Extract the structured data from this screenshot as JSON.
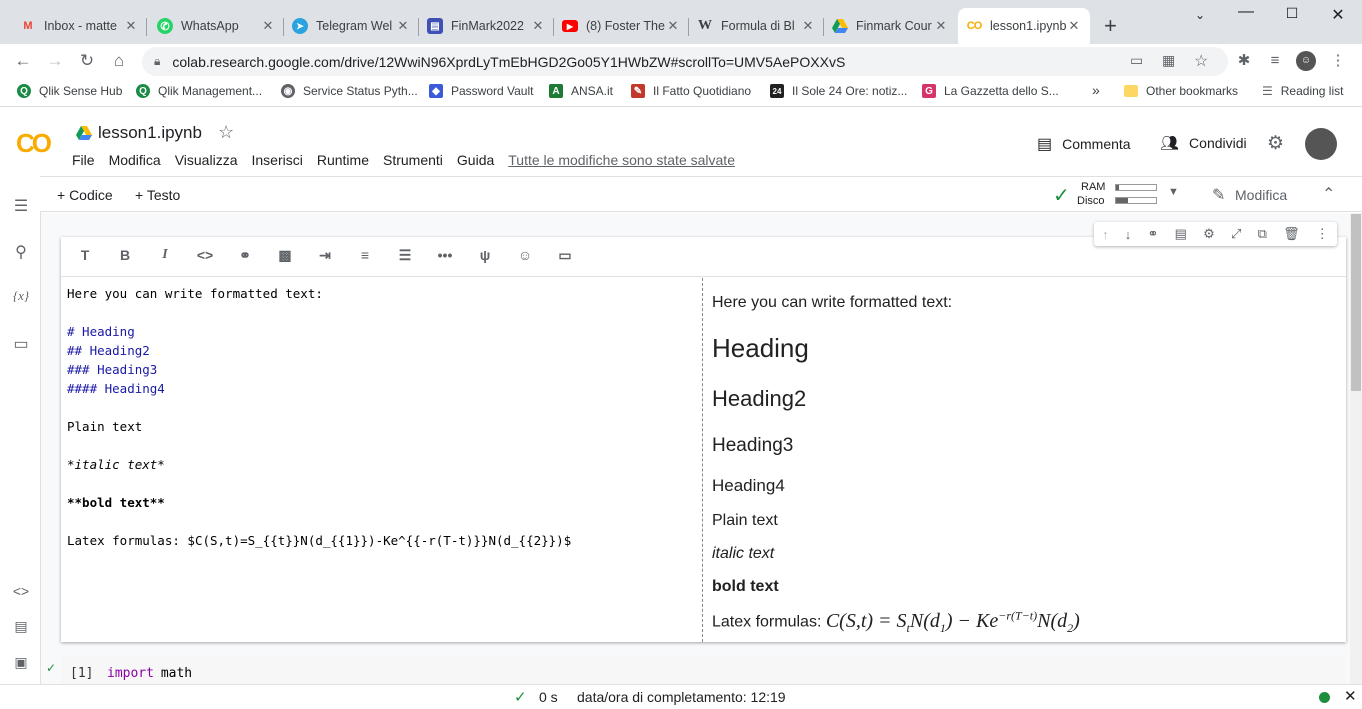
{
  "tabs": [
    {
      "label": "Inbox - matte",
      "icon": "gmail-icon",
      "color": "#ea4335",
      "glyph": "M"
    },
    {
      "label": "WhatsApp",
      "icon": "whatsapp-icon",
      "color": "#25d366",
      "glyph": "✆"
    },
    {
      "label": "Telegram Wel",
      "icon": "telegram-icon",
      "color": "#2aa3df",
      "glyph": "➤"
    },
    {
      "label": "FinMark2022",
      "icon": "forms-icon",
      "color": "#3f51b5",
      "glyph": "▤"
    },
    {
      "label": "(8) Foster The",
      "icon": "youtube-icon",
      "color": "#ff0000",
      "glyph": "▶"
    },
    {
      "label": "Formula di Bl",
      "icon": "wikipedia-icon",
      "color": "#fff",
      "glyph": "W"
    },
    {
      "label": "Finmark Cour",
      "icon": "drive-icon",
      "color": "#fff",
      "glyph": "▲"
    },
    {
      "label": "lesson1.ipynb",
      "icon": "colab-icon",
      "color": "#fff",
      "glyph": "CO"
    }
  ],
  "url": "colab.research.google.com/drive/12WwiN96XprdLyTmEbHGD2Go05Y1HWbZW#scrollTo=UMV5AePOXXvS",
  "bookmarks": [
    {
      "label": "Qlik Sense Hub",
      "color": "#1a8b45",
      "glyph": "Q"
    },
    {
      "label": "Qlik Management...",
      "color": "#1a8b45",
      "glyph": "Q"
    },
    {
      "label": "Service Status Pyth...",
      "color": "#5f6368",
      "glyph": "◉"
    },
    {
      "label": "Password Vault",
      "color": "#3b5bdb",
      "glyph": "◆"
    },
    {
      "label": "ANSA.it",
      "color": "#1d7a34",
      "glyph": "A"
    },
    {
      "label": "Il Fatto Quotidiano",
      "color": "#c0392b",
      "glyph": "✎"
    },
    {
      "label": "Il Sole 24 Ore: notiz...",
      "color": "#222",
      "glyph": "24"
    },
    {
      "label": "La Gazzetta dello S...",
      "color": "#d6336c",
      "glyph": "G"
    }
  ],
  "other_bookmarks": "Other bookmarks",
  "reading_list": "Reading list",
  "more_bookmarks": "»",
  "notebook": {
    "name": "lesson1.ipynb",
    "logo": "CO"
  },
  "menu": [
    "File",
    "Modifica",
    "Visualizza",
    "Inserisci",
    "Runtime",
    "Strumenti",
    "Guida"
  ],
  "saved_status": "Tutte le modifiche sono state salvate",
  "header_buttons": {
    "comment": "Commenta",
    "share": "Condividi"
  },
  "toolbar": {
    "add_code": "+ Codice",
    "add_text": "+ Testo",
    "ram": "RAM",
    "disk": "Disco",
    "edit": "Modifica"
  },
  "editor": {
    "line1": "Here you can write formatted text:",
    "h1": "# Heading",
    "h2": "## Heading2",
    "h3": "### Heading3",
    "h4": "#### Heading4",
    "plain": "Plain text",
    "italic": "*italic text*",
    "bold": "**bold text**",
    "latex_label": "Latex formulas: ",
    "latex_src": "$C(S,t)=S_{{t}}N(d_{{1}})-Ke^{{-r(T-t)}}N(d_{{2}})$"
  },
  "preview": {
    "line1": "Here you can write formatted text:",
    "h1": "Heading",
    "h2": "Heading2",
    "h3": "Heading3",
    "h4": "Heading4",
    "plain": "Plain text",
    "italic": "italic text",
    "bold": "bold text",
    "latex_label": "Latex formulas: "
  },
  "code_cell": {
    "exec": "[1]",
    "code_kw": "import",
    "code_rest": " math"
  },
  "status": {
    "duration": "0 s",
    "completed": "data/ora di completamento: 12:19"
  }
}
